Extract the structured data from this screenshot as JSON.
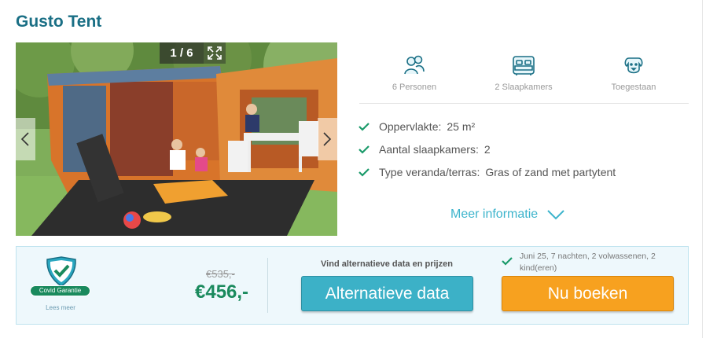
{
  "title": "Gusto Tent",
  "gallery": {
    "counter": "1 / 6"
  },
  "features": [
    {
      "icon": "persons-icon",
      "label": "6 Personen"
    },
    {
      "icon": "bedroom-icon",
      "label": "2 Slaapkamers"
    },
    {
      "icon": "dog-icon",
      "label": "Toegestaan"
    }
  ],
  "specs": [
    {
      "key": "Oppervlakte:",
      "value": "25 m²"
    },
    {
      "key": "Aantal slaapkamers:",
      "value": "2"
    },
    {
      "key": "Type veranda/terras:",
      "value": "Gras of zand met partytent"
    }
  ],
  "more_info": "Meer informatie",
  "booking": {
    "covid_label": "Covid Garantie",
    "covid_more": "Lees meer",
    "old_price": "€535,-",
    "price": "€456,-",
    "alt_heading": "Vind alternatieve data en prijzen",
    "alt_button": "Alternatieve data",
    "book_button": "Nu boeken",
    "selection": "Juni 25, 7 nachten, 2 volwassenen, 2 kind(eren)"
  },
  "colors": {
    "title": "#1a6f85",
    "accent": "#3db4cc",
    "price": "#1a8a5d",
    "book": "#f7a11f",
    "check": "#1a9a6a"
  }
}
